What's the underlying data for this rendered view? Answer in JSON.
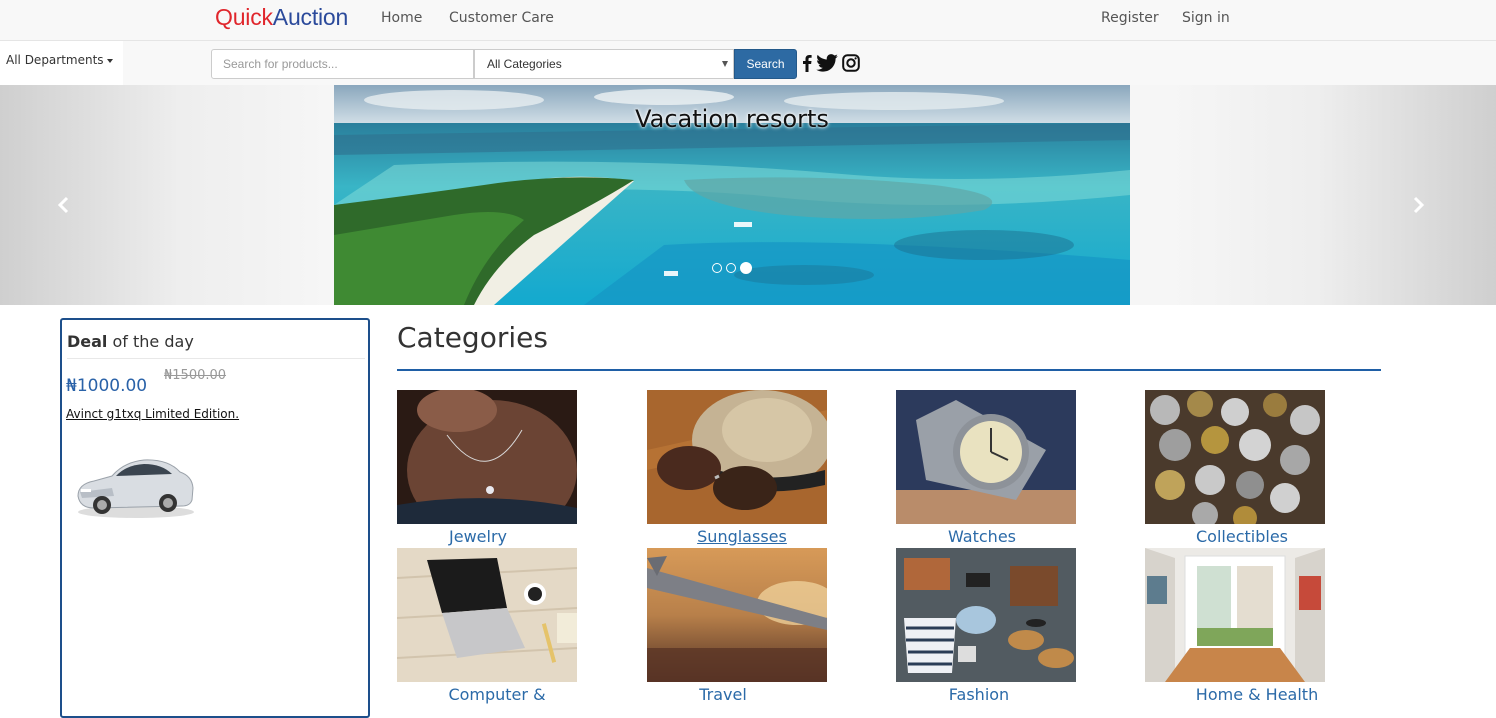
{
  "brand": {
    "part1": "Quick",
    "part2": "Auction"
  },
  "nav": {
    "home": "Home",
    "customer_care": "Customer Care",
    "register": "Register",
    "sign_in": "Sign in"
  },
  "search": {
    "departments": "All Departments",
    "placeholder": "Search for products...",
    "category": "All Categories",
    "button": "Search"
  },
  "social": [
    "facebook-icon",
    "twitter-icon",
    "instagram-icon"
  ],
  "carousel": {
    "caption": "Vacation resorts",
    "slide_count": 3,
    "active_index": 3
  },
  "deal": {
    "title_bold": "Deal",
    "title_rest": " of the day",
    "price": "₦1000.00",
    "old_price": "₦1500.00",
    "product": "Avinct g1txq Limited Edition."
  },
  "categories": {
    "heading": "Categories",
    "items": [
      {
        "label": "Jewelry"
      },
      {
        "label": "Sunglasses"
      },
      {
        "label": "Watches"
      },
      {
        "label": "Collectibles"
      },
      {
        "label": "Computer &"
      },
      {
        "label": "Travel"
      },
      {
        "label": "Fashion"
      },
      {
        "label": "Home & Health"
      }
    ]
  },
  "colors": {
    "brand_red": "#e0262c",
    "brand_blue": "#2b4a9b",
    "accent": "#2d6aa3",
    "link": "#2b6aa8"
  }
}
